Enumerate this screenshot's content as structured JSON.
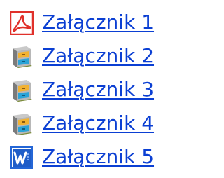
{
  "attachments": [
    {
      "label": "Załącznik 1",
      "icon": "pdf-icon"
    },
    {
      "label": "Załącznik 2",
      "icon": "file-cabinet-icon"
    },
    {
      "label": "Załącznik 3",
      "icon": "file-cabinet-icon"
    },
    {
      "label": "Załącznik 4",
      "icon": "file-cabinet-icon"
    },
    {
      "label": "Załącznik 5",
      "icon": "word-document-icon"
    }
  ],
  "colors": {
    "link": "#0b3fd3",
    "pdf_red": "#e0312b",
    "word_blue": "#1f5dc8"
  }
}
